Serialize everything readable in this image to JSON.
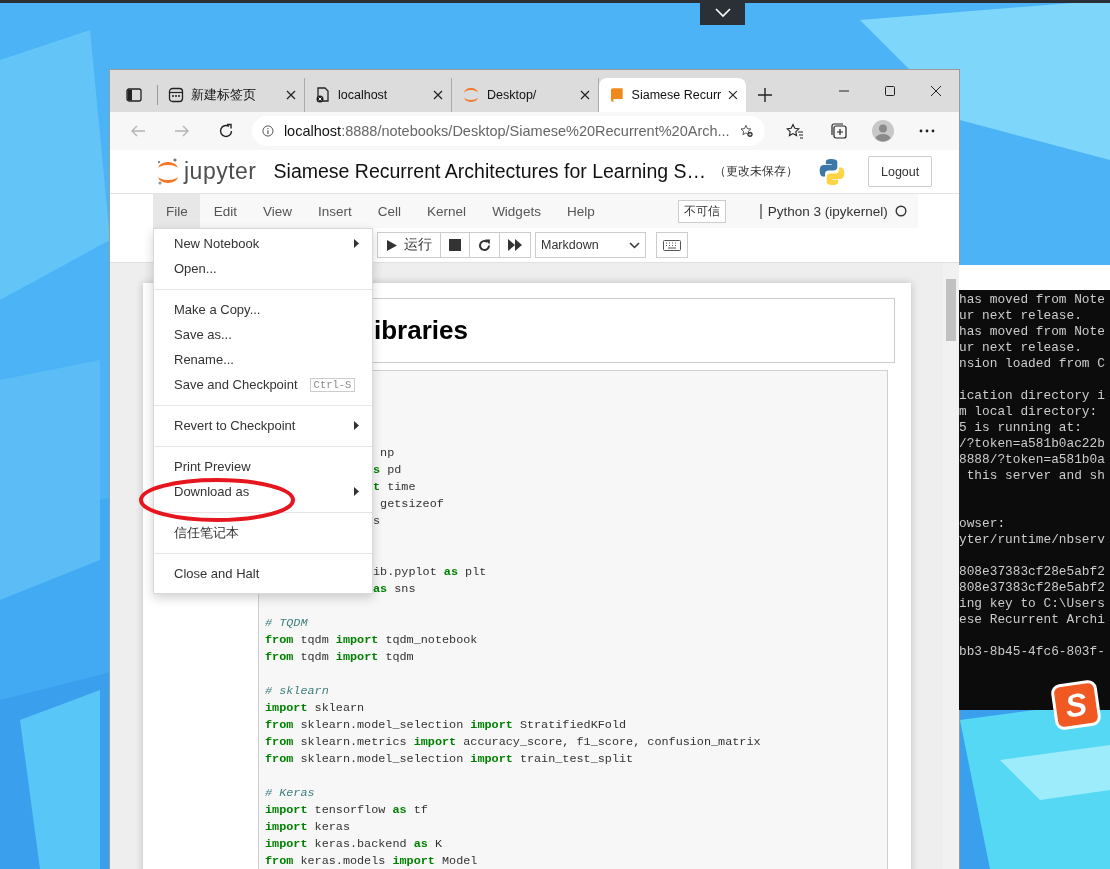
{
  "browser": {
    "tabs": [
      {
        "kind": "newtab",
        "title": "新建标签页",
        "selected": false
      },
      {
        "kind": "page",
        "title": "localhost",
        "selected": false
      },
      {
        "kind": "jupyter",
        "title": "Desktop/",
        "selected": false
      },
      {
        "kind": "notebook",
        "title": "Siamese Recurr",
        "selected": true
      }
    ],
    "back_disabled": true,
    "forward_disabled": true,
    "address": {
      "host": "localhost",
      "path": ":8888/notebooks/Desktop/Siamese%20Recurrent%20Arch..."
    }
  },
  "notebook": {
    "logo_text": "jupyter",
    "title": "Siamese Recurrent Architectures for Learning S…",
    "save_status": "（更改未保存）",
    "logout": "Logout",
    "menus": [
      {
        "label": "File",
        "selected": true
      },
      {
        "label": "Edit",
        "selected": false
      },
      {
        "label": "View",
        "selected": false
      },
      {
        "label": "Insert",
        "selected": false
      },
      {
        "label": "Cell",
        "selected": false
      },
      {
        "label": "Kernel",
        "selected": false
      },
      {
        "label": "Widgets",
        "selected": false
      },
      {
        "label": "Help",
        "selected": false
      }
    ],
    "trust": "不可信",
    "kernel": "Python 3 (ipykernel)",
    "kernel_busy": false,
    "toolbar": {
      "run": "运行",
      "cell_type": "Markdown"
    },
    "file_menu": [
      [
        {
          "label": "New Notebook",
          "submenu": true
        },
        {
          "label": "Open...",
          "submenu": false
        }
      ],
      [
        {
          "label": "Make a Copy...",
          "submenu": false
        },
        {
          "label": "Save as...",
          "submenu": false
        },
        {
          "label": "Rename...",
          "submenu": false
        },
        {
          "label": "Save and Checkpoint",
          "submenu": false,
          "shortcut": "Ctrl-S"
        }
      ],
      [
        {
          "label": "Revert to Checkpoint",
          "submenu": true
        }
      ],
      [
        {
          "label": "Print Preview",
          "submenu": false
        },
        {
          "label": "Download as",
          "submenu": true
        }
      ],
      [
        {
          "label": "信任笔记本",
          "submenu": false
        }
      ],
      [
        {
          "label": "Close and Halt",
          "submenu": false
        }
      ]
    ],
    "heading": "ibraries",
    "code_lines": [
      {
        "kind": "blank"
      },
      {
        "kind": "blank"
      },
      {
        "kind": "blank"
      },
      {
        "kind": "blank"
      },
      {
        "kind": "partial",
        "parts": [
          {
            "kind": "plain",
            "text": " np"
          }
        ]
      },
      {
        "kind": "partial",
        "parts": [
          {
            "kind": "keyword",
            "text": "s"
          },
          {
            "kind": "plain",
            "text": " pd"
          }
        ]
      },
      {
        "kind": "partial",
        "parts": [
          {
            "kind": "keyword",
            "text": "t"
          },
          {
            "kind": "plain",
            "text": " time"
          }
        ]
      },
      {
        "kind": "partial",
        "parts": [
          {
            "kind": "plain",
            "text": " getsizeof"
          }
        ]
      },
      {
        "kind": "partial",
        "parts": [
          {
            "kind": "plain",
            "text": "s"
          }
        ]
      },
      {
        "kind": "blank"
      },
      {
        "kind": "blank"
      },
      {
        "kind": "partial",
        "parts": [
          {
            "kind": "plain",
            "text": "ib.pyplot "
          },
          {
            "kind": "keyword",
            "text": "as"
          },
          {
            "kind": "plain",
            "text": " plt"
          }
        ]
      },
      {
        "kind": "partial",
        "parts": [
          {
            "kind": "keyword",
            "text": "as"
          },
          {
            "kind": "plain",
            "text": " sns"
          }
        ]
      },
      {
        "kind": "blank"
      },
      {
        "kind": "code",
        "parts": [
          {
            "kind": "comment",
            "text": "# TQDM"
          }
        ]
      },
      {
        "kind": "code",
        "parts": [
          {
            "kind": "keyword",
            "text": "from"
          },
          {
            "kind": "plain",
            "text": " tqdm "
          },
          {
            "kind": "keyword",
            "text": "import"
          },
          {
            "kind": "plain",
            "text": " tqdm_notebook"
          }
        ]
      },
      {
        "kind": "code",
        "parts": [
          {
            "kind": "keyword",
            "text": "from"
          },
          {
            "kind": "plain",
            "text": " tqdm "
          },
          {
            "kind": "keyword",
            "text": "import"
          },
          {
            "kind": "plain",
            "text": " tqdm"
          }
        ]
      },
      {
        "kind": "blank"
      },
      {
        "kind": "code",
        "parts": [
          {
            "kind": "comment",
            "text": "# sklearn"
          }
        ]
      },
      {
        "kind": "code",
        "parts": [
          {
            "kind": "keyword",
            "text": "import"
          },
          {
            "kind": "plain",
            "text": " sklearn"
          }
        ]
      },
      {
        "kind": "code",
        "parts": [
          {
            "kind": "keyword",
            "text": "from"
          },
          {
            "kind": "plain",
            "text": " sklearn.model_selection "
          },
          {
            "kind": "keyword",
            "text": "import"
          },
          {
            "kind": "plain",
            "text": " StratifiedKFold"
          }
        ]
      },
      {
        "kind": "code",
        "parts": [
          {
            "kind": "keyword",
            "text": "from"
          },
          {
            "kind": "plain",
            "text": " sklearn.metrics "
          },
          {
            "kind": "keyword",
            "text": "import"
          },
          {
            "kind": "plain",
            "text": " accuracy_score, f1_score, confusion_matrix"
          }
        ]
      },
      {
        "kind": "code",
        "parts": [
          {
            "kind": "keyword",
            "text": "from"
          },
          {
            "kind": "plain",
            "text": " sklearn.model_selection "
          },
          {
            "kind": "keyword",
            "text": "import"
          },
          {
            "kind": "plain",
            "text": " train_test_split"
          }
        ]
      },
      {
        "kind": "blank"
      },
      {
        "kind": "code",
        "parts": [
          {
            "kind": "comment",
            "text": "# Keras"
          }
        ]
      },
      {
        "kind": "code",
        "parts": [
          {
            "kind": "keyword",
            "text": "import"
          },
          {
            "kind": "plain",
            "text": " tensorflow "
          },
          {
            "kind": "keyword",
            "text": "as"
          },
          {
            "kind": "plain",
            "text": " tf"
          }
        ]
      },
      {
        "kind": "code",
        "parts": [
          {
            "kind": "keyword",
            "text": "import"
          },
          {
            "kind": "plain",
            "text": " keras"
          }
        ]
      },
      {
        "kind": "code",
        "parts": [
          {
            "kind": "keyword",
            "text": "import"
          },
          {
            "kind": "plain",
            "text": " keras.backend "
          },
          {
            "kind": "keyword",
            "text": "as"
          },
          {
            "kind": "plain",
            "text": " K"
          }
        ]
      },
      {
        "kind": "code",
        "parts": [
          {
            "kind": "keyword",
            "text": "from"
          },
          {
            "kind": "plain",
            "text": " keras.models "
          },
          {
            "kind": "keyword",
            "text": "import"
          },
          {
            "kind": "plain",
            "text": " Model"
          }
        ]
      }
    ]
  },
  "terminal": {
    "lines": [
      {
        "kind": "text",
        "text": "has moved from Note"
      },
      {
        "kind": "text",
        "text": "ur next release."
      },
      {
        "kind": "text",
        "text": "has moved from Note"
      },
      {
        "kind": "text",
        "text": "ur next release."
      },
      {
        "kind": "text",
        "text": "nsion loaded from C"
      },
      {
        "kind": "blank"
      },
      {
        "kind": "text",
        "text": "ication directory i"
      },
      {
        "kind": "text",
        "text": "m local directory:"
      },
      {
        "kind": "text",
        "text": "5 is running at:"
      },
      {
        "kind": "text",
        "text": "/?token=a581b0ac22b"
      },
      {
        "kind": "text",
        "text": "8888/?token=a581b0a"
      },
      {
        "kind": "text",
        "text": " this server and sh"
      },
      {
        "kind": "blank"
      },
      {
        "kind": "blank"
      },
      {
        "kind": "text",
        "text": "owser:"
      },
      {
        "kind": "text",
        "text": "yter/runtime/nbserv"
      },
      {
        "kind": "blank"
      },
      {
        "kind": "text",
        "text": "808e37383cf28e5abf2"
      },
      {
        "kind": "text",
        "text": "808e37383cf28e5abf2"
      },
      {
        "kind": "text",
        "text": "ing key to C:\\Users"
      },
      {
        "kind": "text",
        "text": "ese Recurrent Archi"
      },
      {
        "kind": "blank"
      },
      {
        "kind": "text",
        "text": "bb3-8b45-4fc6-803f-"
      }
    ]
  },
  "tray_logo": "S"
}
